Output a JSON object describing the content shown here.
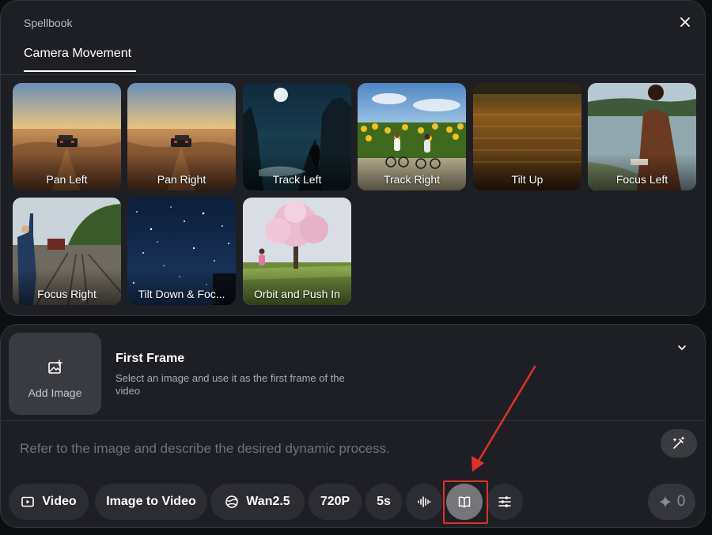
{
  "spellbook": {
    "title": "Spellbook",
    "close_icon": "close-icon",
    "active_tab": "Camera Movement",
    "presets": [
      {
        "label": "Pan Left",
        "scene": "desert-car"
      },
      {
        "label": "Pan Right",
        "scene": "desert-car"
      },
      {
        "label": "Track Left",
        "scene": "night-coast-moon"
      },
      {
        "label": "Track Right",
        "scene": "sunflower-cyclists"
      },
      {
        "label": "Tilt Up",
        "scene": "wheat-field"
      },
      {
        "label": "Focus Left",
        "scene": "lake-woman-reading"
      },
      {
        "label": "Focus Right",
        "scene": "railway-man-waving"
      },
      {
        "label": "Tilt Down & Foc...",
        "scene": "starry-night-sky"
      },
      {
        "label": "Orbit and Push In",
        "scene": "cherry-blossom-girl"
      }
    ]
  },
  "composer": {
    "add_image_label": "Add Image",
    "first_frame_title": "First Frame",
    "first_frame_desc": "Select an image and use it as the first frame of the video",
    "prompt_placeholder": "Refer to the image and describe the desired dynamic process.",
    "prompt_value": "",
    "toolbar": {
      "mode_label": "Video",
      "type_label": "Image to Video",
      "model_label": "Wan2.5",
      "resolution_label": "720P",
      "duration_label": "5s",
      "audio_icon": "audio-waveform-icon",
      "spellbook_icon": "book-icon",
      "settings_icon": "sliders-icon"
    },
    "generate_cost": "0"
  },
  "colors": {
    "panel_bg": "#1e1f25",
    "pill_bg": "#2c2d33",
    "active_pill_bg": "#75767a",
    "annotation_red": "#e03127"
  }
}
